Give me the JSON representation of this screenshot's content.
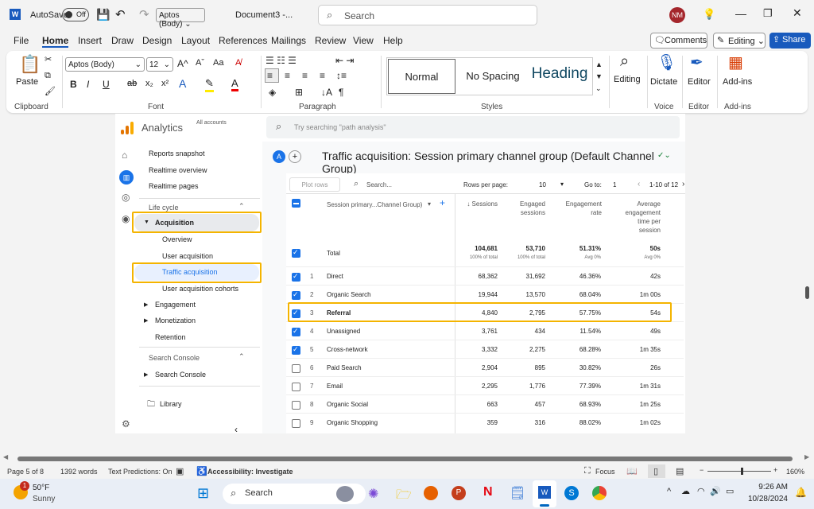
{
  "titlebar": {
    "autosave": "AutoSave",
    "toggle": "Off",
    "font_select": "Aptos (Body)",
    "doc_title": "Document3  -...",
    "search_placeholder": "Search",
    "avatar": "NM"
  },
  "tabs": [
    "File",
    "Home",
    "Insert",
    "Draw",
    "Design",
    "Layout",
    "References",
    "Mailings",
    "Review",
    "View",
    "Help"
  ],
  "tab_buttons": {
    "comments": "Comments",
    "editing": "Editing",
    "share": "Share"
  },
  "ribbon": {
    "paste": "Paste",
    "clipboard": "Clipboard",
    "font_name": "Aptos (Body)",
    "font_size": "12",
    "font": "Font",
    "paragraph": "Paragraph",
    "styles": [
      "Normal",
      "No Spacing",
      "Heading"
    ],
    "styles_label": "Styles",
    "editing": "Editing",
    "dictate": "Dictate",
    "voice": "Voice",
    "editor": "Editor",
    "editor_label": "Editor",
    "addins": "Add-ins",
    "addins_label": "Add-ins"
  },
  "analytics": {
    "brand": "Analytics",
    "account": "All accounts",
    "search_placeholder": "Try searching \"path analysis\"",
    "avatar": "A",
    "nav": {
      "top": [
        "Reports snapshot",
        "Realtime overview",
        "Realtime pages"
      ],
      "lifecycle": "Life cycle",
      "acquisition": "Acquisition",
      "acq_items": [
        "Overview",
        "User acquisition",
        "Traffic acquisition",
        "User acquisition cohorts"
      ],
      "others": [
        "Engagement",
        "Monetization",
        "Retention"
      ],
      "search_console_header": "Search Console",
      "search_console": "Search Console",
      "library": "Library"
    },
    "report_title": "Traffic acquisition: Session primary channel group (Default Channel Group)",
    "toolbar": {
      "plot_rows": "Plot rows",
      "search": "Search...",
      "rows_per_page_label": "Rows per page:",
      "rows_per_page": "10",
      "goto_label": "Go to:",
      "goto": "1",
      "range": "1-10 of 12"
    },
    "columns": {
      "dimension": "Session primary...Channel Group)",
      "sessions": "↓ Sessions",
      "engaged": "Engaged sessions",
      "rate": "Engagement rate",
      "avg": "Average engagement time per session"
    },
    "total": {
      "label": "Total",
      "sessions": "104,681",
      "sessions_sub": "100% of total",
      "engaged": "53,710",
      "engaged_sub": "100% of total",
      "rate": "51.31%",
      "rate_sub": "Avg 0%",
      "avg": "50s",
      "avg_sub": "Avg 0%"
    },
    "rows": [
      {
        "n": "1",
        "name": "Direct",
        "sessions": "68,362",
        "engaged": "31,692",
        "rate": "46.36%",
        "avg": "42s",
        "checked": true
      },
      {
        "n": "2",
        "name": "Organic Search",
        "sessions": "19,944",
        "engaged": "13,570",
        "rate": "68.04%",
        "avg": "1m 00s",
        "checked": true
      },
      {
        "n": "3",
        "name": "Referral",
        "sessions": "4,840",
        "engaged": "2,795",
        "rate": "57.75%",
        "avg": "54s",
        "checked": true
      },
      {
        "n": "4",
        "name": "Unassigned",
        "sessions": "3,761",
        "engaged": "434",
        "rate": "11.54%",
        "avg": "49s",
        "checked": true
      },
      {
        "n": "5",
        "name": "Cross-network",
        "sessions": "3,332",
        "engaged": "2,275",
        "rate": "68.28%",
        "avg": "1m 35s",
        "checked": true
      },
      {
        "n": "6",
        "name": "Paid Search",
        "sessions": "2,904",
        "engaged": "895",
        "rate": "30.82%",
        "avg": "26s",
        "checked": false
      },
      {
        "n": "7",
        "name": "Email",
        "sessions": "2,295",
        "engaged": "1,776",
        "rate": "77.39%",
        "avg": "1m 31s",
        "checked": false
      },
      {
        "n": "8",
        "name": "Organic Social",
        "sessions": "663",
        "engaged": "457",
        "rate": "68.93%",
        "avg": "1m 25s",
        "checked": false
      },
      {
        "n": "9",
        "name": "Organic Shopping",
        "sessions": "359",
        "engaged": "316",
        "rate": "88.02%",
        "avg": "1m 02s",
        "checked": false
      }
    ]
  },
  "status": {
    "page": "Page 5 of 8",
    "words": "1392 words",
    "predictions": "Text Predictions: On",
    "accessibility": "Accessibility: Investigate",
    "focus": "Focus",
    "zoom": "160%"
  },
  "taskbar": {
    "temp": "50°F",
    "weather": "Sunny",
    "badge": "1",
    "search": "Search",
    "time": "9:26 AM",
    "date": "10/28/2024"
  },
  "colors": {
    "accent": "#1a73e8",
    "highlight": "#f4b400",
    "word_blue": "#185abd"
  }
}
